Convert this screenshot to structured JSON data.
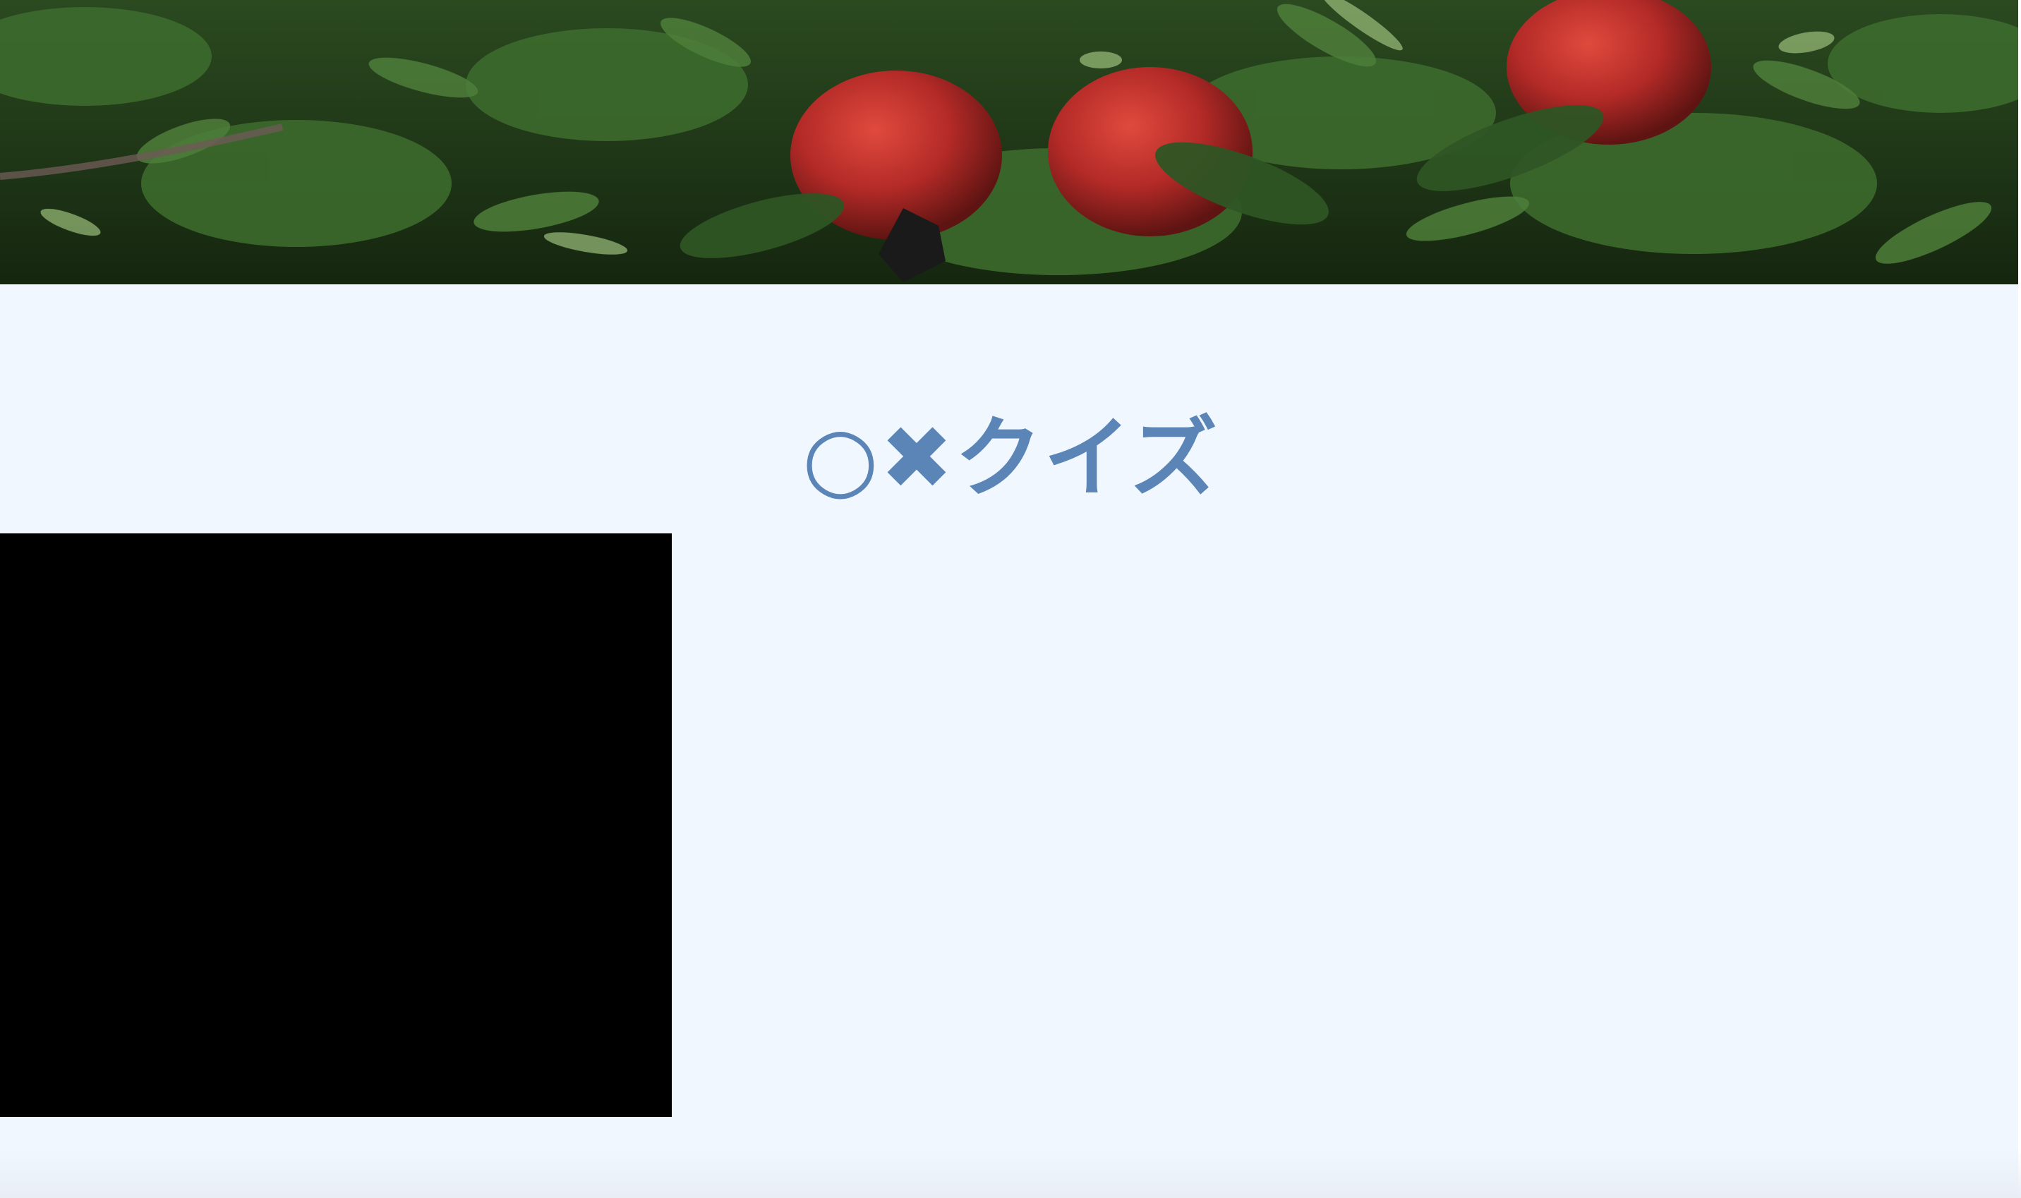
{
  "hero": {
    "image": "pomegranate-tree-photo",
    "colors": {
      "foliage_dark": "#17290f",
      "foliage": "#2f5523",
      "leaf_light": "#6f9a55",
      "fruit": "#b82c2c",
      "fruit_highlight": "#d9473c"
    }
  },
  "main": {
    "title": "○✖クイズ",
    "title_color": "#5b85b6",
    "background": "#f0f7fe"
  },
  "media": {
    "video_placeholder_color": "#000000"
  }
}
